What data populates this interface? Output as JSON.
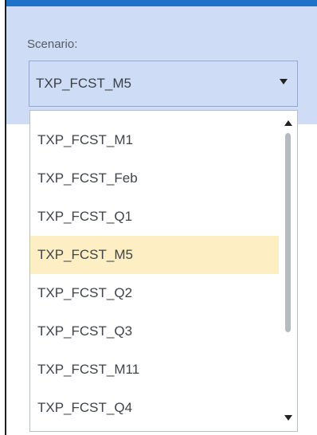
{
  "scenario": {
    "label": "Scenario:",
    "selected": "TXP_FCST_M5",
    "options": [
      "TXP_FCST_M1",
      "TXP_FCST_Feb",
      "TXP_FCST_Q1",
      "TXP_FCST_M5",
      "TXP_FCST_Q2",
      "TXP_FCST_Q3",
      "TXP_FCST_M11",
      "TXP_FCST_Q4"
    ],
    "selected_index": 3
  },
  "icons": {
    "select_arrow": "chevron-down-icon",
    "scroll_up": "scroll-up-arrow-icon",
    "scroll_down": "scroll-down-arrow-icon"
  },
  "colors": {
    "top_bar": "#1e72c8",
    "panel_background": "#cfdcf5",
    "selected_option": "#fdeec3"
  }
}
